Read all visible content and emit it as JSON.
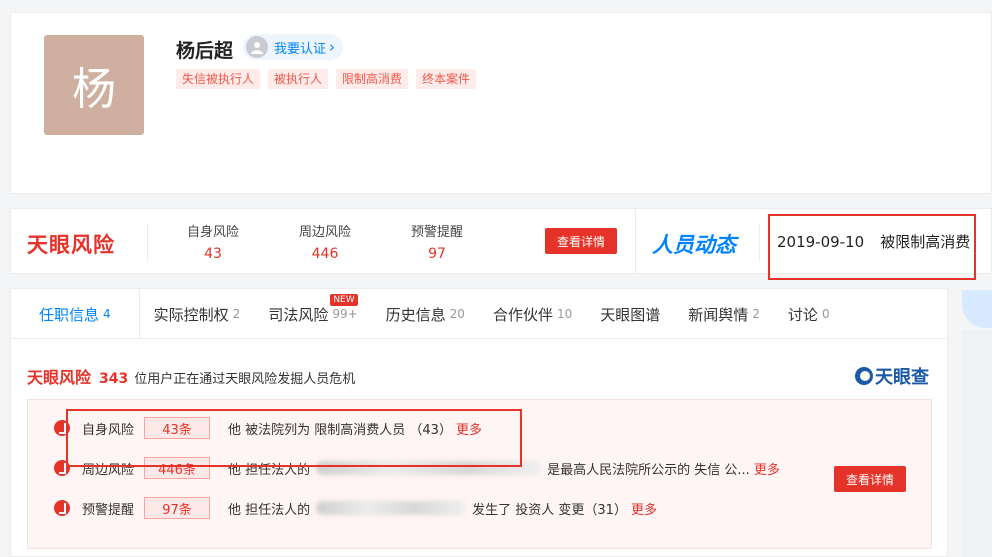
{
  "profile": {
    "avatar_char": "杨",
    "name": "杨后超",
    "verify_label": "我要认证",
    "verify_chevron": "›",
    "tags": [
      "失信被执行人",
      "被执行人",
      "限制高消费",
      "终本案件"
    ]
  },
  "riskbar": {
    "logo": "天眼风险",
    "stats": [
      {
        "label": "自身风险",
        "value": "43"
      },
      {
        "label": "周边风险",
        "value": "446"
      },
      {
        "label": "预警提醒",
        "value": "97"
      }
    ],
    "details_button": "查看详情",
    "dynamics_title": "人员动态",
    "dynamics_date": "2019-09-10",
    "dynamics_text": "被限制高消费"
  },
  "tabs": [
    {
      "label": "任职信息",
      "count": "4",
      "active": true
    },
    {
      "label": "实际控制权",
      "count": "2"
    },
    {
      "label": "司法风险",
      "count": "99+",
      "badge": "NEW"
    },
    {
      "label": "历史信息",
      "count": "20"
    },
    {
      "label": "合作伙伴",
      "count": "10"
    },
    {
      "label": "天眼图谱",
      "count": ""
    },
    {
      "label": "新闻舆情",
      "count": "2"
    },
    {
      "label": "讨论",
      "count": "0"
    }
  ],
  "risk_section": {
    "logo": "天眼风险",
    "user_count": "343",
    "intro": "位用户正在通过天眼风险发掘人员危机",
    "brand": "天眼查",
    "rows": [
      {
        "label": "自身风险",
        "count": "43条",
        "pre": "他 被法院列为 限制高消费人员 （43）",
        "mid": "",
        "post": "",
        "more": "更多"
      },
      {
        "label": "周边风险",
        "count": "446条",
        "pre": "他 担任法人的",
        "mid": "",
        "post": "是最高人民法院所公示的 失信 公...",
        "more": "更多"
      },
      {
        "label": "预警提醒",
        "count": "97条",
        "pre": "他 担任法人的",
        "mid": "",
        "post": "发生了 投资人 变更（31）",
        "more": "更多"
      }
    ],
    "details_button": "查看详情"
  }
}
